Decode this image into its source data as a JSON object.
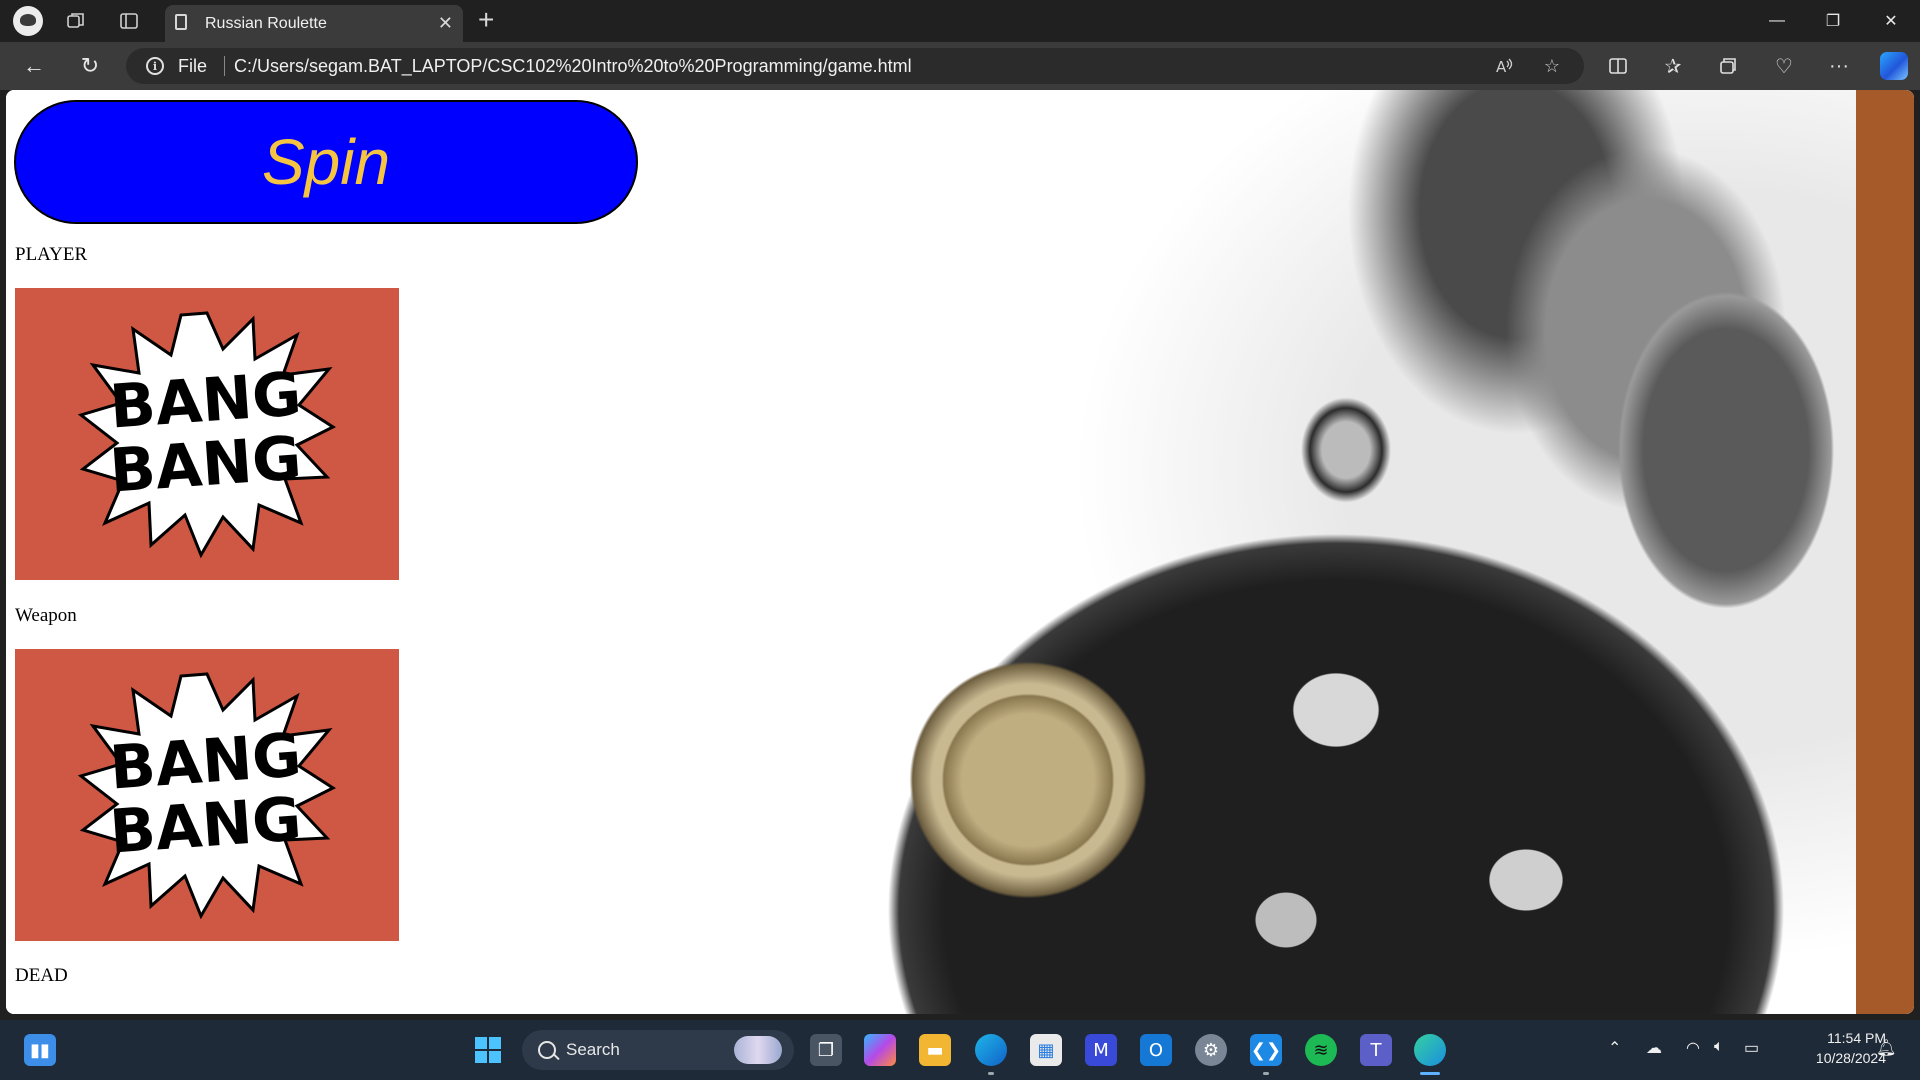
{
  "browser": {
    "tab_title": "Russian Roulette",
    "new_tab": "+",
    "close_tab": "✕",
    "window_controls": {
      "minimize": "—",
      "maximize": "❐",
      "close": "✕"
    }
  },
  "toolbar": {
    "back": "←",
    "refresh": "↻",
    "info": "i",
    "file_label": "File",
    "url": "C:/Users/segam.BAT_LAPTOP/CSC102%20Intro%20to%20Programming/game.html",
    "more": "···"
  },
  "page": {
    "spin_label": "Spin",
    "player_label": "PLAYER",
    "weapon_label": "Weapon",
    "dead_label": "DEAD",
    "image_text_line1": "BANG",
    "image_text_line2": "BANG"
  },
  "taskbar": {
    "search_label": "Search",
    "time": "11:54 PM",
    "date": "10/28/2024"
  },
  "colors": {
    "spin_bg": "#0000ff",
    "spin_text": "#f5c542",
    "bang_bg": "#cf5844"
  }
}
